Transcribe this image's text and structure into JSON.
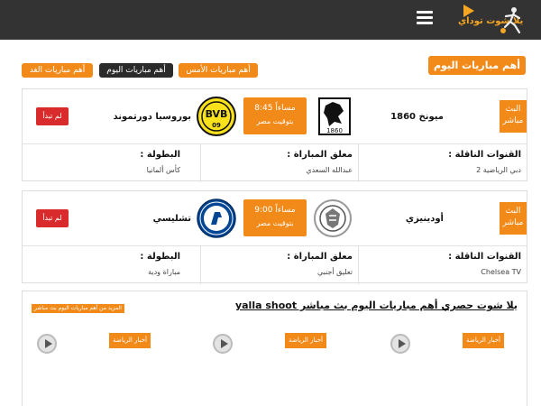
{
  "header": {
    "logo_text": "يلا شوت توداي",
    "menu_icon": "hamburger-menu-icon"
  },
  "section_title": "أهم مباريات اليوم",
  "tabs": [
    {
      "label": "أهم مباريات الأمس",
      "style": "orange"
    },
    {
      "label": "أهم مباريات اليوم",
      "style": "dark"
    },
    {
      "label": "أهم مباريات الغد",
      "style": "orange"
    }
  ],
  "matches": [
    {
      "live_label": "البث مباشر",
      "home_team": "ميونخ 1860",
      "home_logo": "tsv-1860-munich-crest",
      "away_team": "بوروسيا دورتموند",
      "away_logo": "borussia-dortmund-crest",
      "time": "8:45 مساءاً",
      "timezone": "بتوقيت مصر",
      "status": "لم تبدأ",
      "channels_label": "القنوات الناقلة :",
      "channels_value": "دبي الرياضية 2",
      "commentator_label": "معلق المباراة :",
      "commentator_value": "عبدالله السعدي",
      "league_label": "البطولة :",
      "league_value": "كأس ألمانيا"
    },
    {
      "live_label": "البث مباشر",
      "home_team": "أودينيزي",
      "home_logo": "udinese-crest",
      "away_team": "تشليسي",
      "away_logo": "chelsea-crest",
      "time": "9:00 مساءاً",
      "timezone": "بتوقيت مصر",
      "status": "لم تبدأ",
      "channels_label": "القنوات الناقلة :",
      "channels_value": "Chelsea TV",
      "commentator_label": "معلق المباراة :",
      "commentator_value": "تعليق أجنبي",
      "league_label": "البطولة :",
      "league_value": "مباراة ودية"
    }
  ],
  "news": {
    "heading": "يلا شوت حصري أهم مباريات اليوم بث مباشر yalla shoot",
    "more_link": "المزيد من أهم مباريات اليوم بث مباشر",
    "items": [
      {
        "tag": "أخبار الرياضة"
      },
      {
        "tag": "أخبار الرياضة"
      },
      {
        "tag": "أخبار الرياضة"
      }
    ]
  },
  "colors": {
    "accent": "#f28a1a",
    "topbar": "#333333",
    "status_red": "#d92b2b"
  }
}
